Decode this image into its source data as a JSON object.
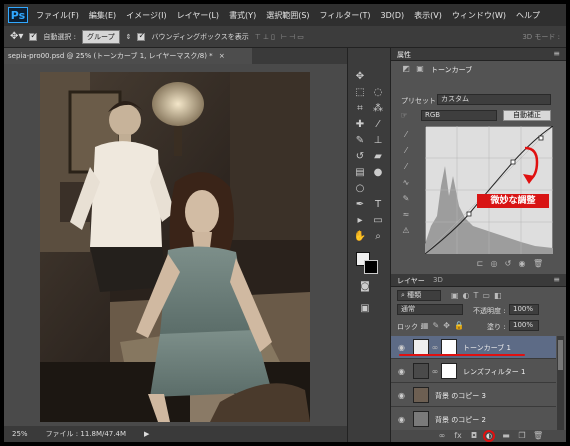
{
  "app": {
    "logo": "Ps"
  },
  "menu": [
    "ファイル(F)",
    "編集(E)",
    "イメージ(I)",
    "レイヤー(L)",
    "書式(Y)",
    "選択範囲(S)",
    "フィルター(T)",
    "3D(D)",
    "表示(V)",
    "ウィンドウ(W)",
    "ヘルプ"
  ],
  "options": {
    "auto_select_label": "自動選択 :",
    "auto_select_value": "グループ",
    "bounding_box_label": "バウンディングボックスを表示",
    "mode_3d": "3D モード :"
  },
  "document": {
    "tab_title": "sepia-pro00.psd @ 25% (トーンカーブ 1, レイヤーマスク/8) *"
  },
  "status": {
    "zoom": "25%",
    "file_info": "ファイル : 11.8M/47.4M"
  },
  "properties": {
    "panel_title": "属性",
    "adjustment_name": "トーンカーブ",
    "preset_label": "プリセット :",
    "preset_value": "カスタム",
    "channel_value": "RGB",
    "auto_button": "自動補正",
    "annotation": "微妙な調整"
  },
  "layers": {
    "tab_layers": "レイヤー",
    "tab_3d": "3D",
    "filter_kind": "種類",
    "blend_mode": "通常",
    "opacity_label": "不透明度 :",
    "opacity_value": "100%",
    "lock_label": "ロック :",
    "fill_label": "塗り :",
    "fill_value": "100%",
    "items": [
      {
        "name": "トーンカーブ 1",
        "selected": true
      },
      {
        "name": "レンズフィルター 1",
        "selected": false
      },
      {
        "name": "背景 のコピー 3",
        "selected": false
      },
      {
        "name": "背景 のコピー 2",
        "selected": false
      }
    ]
  },
  "colors": {
    "annotation_red": "#e01010",
    "selection_blue": "#5d6b86",
    "ps_blue": "#31a8ff"
  }
}
